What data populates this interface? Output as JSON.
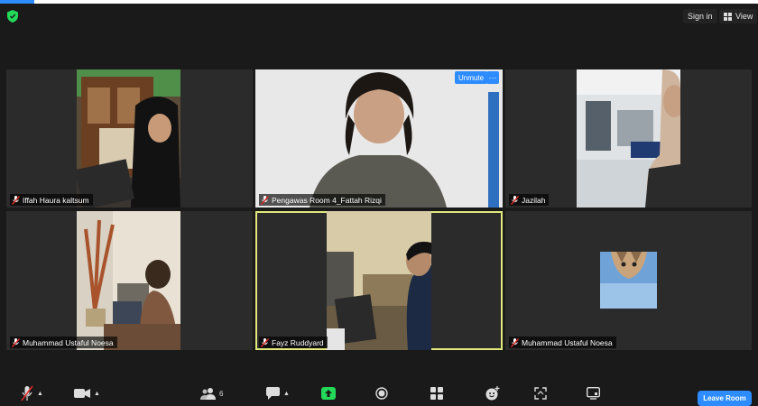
{
  "header": {
    "sign_in": "Sign in",
    "view": "View"
  },
  "tiles": [
    {
      "name": "Iffah Haura kaltsum"
    },
    {
      "name": "Pengawas Room 4_Fattah Rizqi",
      "unmute_label": "Unmute",
      "more_label": "···"
    },
    {
      "name": "Jazilah"
    },
    {
      "name": "Muhammad Ustaful Noesa"
    },
    {
      "name": "Fayz Ruddyard"
    },
    {
      "name": "Muhammad Ustaful Noesa"
    }
  ],
  "toolbar": {
    "participants_count": "6",
    "leave_label": "Leave Room"
  },
  "colors": {
    "accent": "#2d8cff",
    "active_speaker": "#e1e97b",
    "background": "#1a1a1a",
    "tile": "#2b2b2b",
    "mute": "#e02828",
    "share": "#23d959"
  }
}
